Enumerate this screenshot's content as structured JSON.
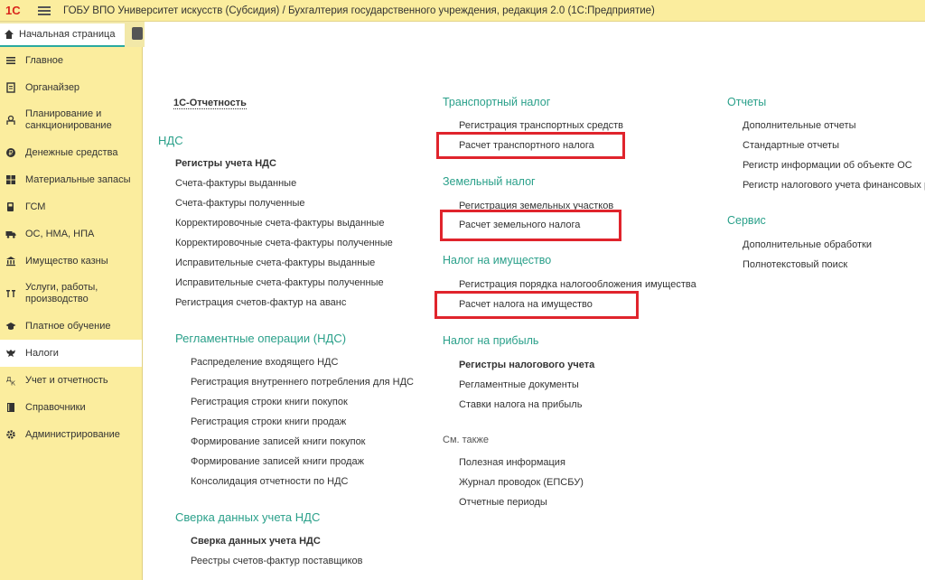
{
  "titlebar": {
    "logo": "1С",
    "title": "ГОБУ ВПО Университет искусств (Субсидия) / Бухгалтерия государственного учреждения, редакция 2.0  (1С:Предприятие)"
  },
  "tabs": {
    "home": "Начальная страница"
  },
  "sidebar": {
    "items": [
      {
        "label": "Главное",
        "icon": "list-icon"
      },
      {
        "label": "Органайзер",
        "icon": "notepad-icon"
      },
      {
        "label": "Планирование и санкционирование",
        "icon": "planning-icon"
      },
      {
        "label": "Денежные средства",
        "icon": "money-icon"
      },
      {
        "label": "Материальные запасы",
        "icon": "grid-icon"
      },
      {
        "label": "ГСМ",
        "icon": "fuel-icon"
      },
      {
        "label": "ОС, НМА, НПА",
        "icon": "truck-icon"
      },
      {
        "label": "Имущество казны",
        "icon": "building-icon"
      },
      {
        "label": "Услуги, работы, производство",
        "icon": "tools-icon"
      },
      {
        "label": "Платное обучение",
        "icon": "graduation-icon"
      },
      {
        "label": "Налоги",
        "icon": "eagle-icon"
      },
      {
        "label": "Учет и отчетность",
        "icon": "accounting-icon"
      },
      {
        "label": "Справочники",
        "icon": "book-icon"
      },
      {
        "label": "Администрирование",
        "icon": "gear-icon"
      }
    ]
  },
  "col1": {
    "report_button": "1С-Отчетность",
    "nds_header": "НДС",
    "nds_links": [
      "Регистры учета НДС",
      "Счета-фактуры выданные",
      "Счета-фактуры полученные",
      "Корректировочные счета-фактуры выданные",
      "Корректировочные счета-фактуры полученные",
      "Исправительные счета-фактуры выданные",
      "Исправительные счета-фактуры полученные",
      "Регистрация счетов-фактур на аванс"
    ],
    "reg_header": "Регламентные операции (НДС)",
    "reg_links": [
      "Распределение входящего НДС",
      "Регистрация внутреннего потребления для НДС",
      "Регистрация строки книги покупок",
      "Регистрация строки книги продаж",
      "Формирование записей книги покупок",
      "Формирование записей книги продаж",
      "Консолидация отчетности по НДС"
    ],
    "reconcile_header": "Сверка данных учета НДС",
    "reconcile_links": [
      "Сверка данных учета НДС",
      "Реестры счетов-фактур поставщиков"
    ]
  },
  "col2": {
    "transport_header": "Транспортный налог",
    "transport_links": [
      "Регистрация транспортных средств",
      "Расчет транспортного налога"
    ],
    "land_header": "Земельный налог",
    "land_links": [
      "Регистрация земельных участков",
      "Расчет земельного налога"
    ],
    "property_header": "Налог на имущество",
    "property_links": [
      "Регистрация порядка налогообложения имущества",
      "Расчет налога на имущество"
    ],
    "profit_header": "Налог на прибыль",
    "profit_links": [
      "Регистры налогового учета",
      "Регламентные документы",
      "Ставки налога на прибыль"
    ],
    "see_also": "См. также",
    "see_also_links": [
      "Полезная информация",
      "Журнал проводок (ЕПСБУ)",
      "Отчетные периоды"
    ]
  },
  "col3": {
    "reports_header": "Отчеты",
    "reports_links": [
      "Дополнительные отчеты",
      "Стандартные отчеты",
      "Регистр информации об объекте ОС",
      "Регистр налогового учета финансовых р"
    ],
    "service_header": "Сервис",
    "service_links": [
      "Дополнительные обработки",
      "Полнотекстовый поиск"
    ]
  },
  "colors": {
    "accent_header": "#2aa08a",
    "sidebar_bg": "#fbed9e",
    "highlight_box": "#e0242c"
  }
}
